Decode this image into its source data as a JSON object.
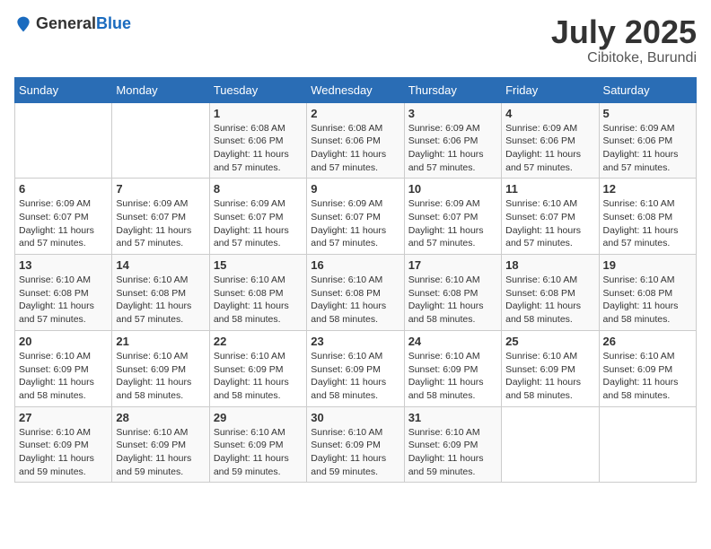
{
  "header": {
    "logo_general": "General",
    "logo_blue": "Blue",
    "month": "July 2025",
    "location": "Cibitoke, Burundi"
  },
  "days_of_week": [
    "Sunday",
    "Monday",
    "Tuesday",
    "Wednesday",
    "Thursday",
    "Friday",
    "Saturday"
  ],
  "weeks": [
    [
      {
        "day": "",
        "info": ""
      },
      {
        "day": "",
        "info": ""
      },
      {
        "day": "1",
        "info": "Sunrise: 6:08 AM\nSunset: 6:06 PM\nDaylight: 11 hours and 57 minutes."
      },
      {
        "day": "2",
        "info": "Sunrise: 6:08 AM\nSunset: 6:06 PM\nDaylight: 11 hours and 57 minutes."
      },
      {
        "day": "3",
        "info": "Sunrise: 6:09 AM\nSunset: 6:06 PM\nDaylight: 11 hours and 57 minutes."
      },
      {
        "day": "4",
        "info": "Sunrise: 6:09 AM\nSunset: 6:06 PM\nDaylight: 11 hours and 57 minutes."
      },
      {
        "day": "5",
        "info": "Sunrise: 6:09 AM\nSunset: 6:06 PM\nDaylight: 11 hours and 57 minutes."
      }
    ],
    [
      {
        "day": "6",
        "info": "Sunrise: 6:09 AM\nSunset: 6:07 PM\nDaylight: 11 hours and 57 minutes."
      },
      {
        "day": "7",
        "info": "Sunrise: 6:09 AM\nSunset: 6:07 PM\nDaylight: 11 hours and 57 minutes."
      },
      {
        "day": "8",
        "info": "Sunrise: 6:09 AM\nSunset: 6:07 PM\nDaylight: 11 hours and 57 minutes."
      },
      {
        "day": "9",
        "info": "Sunrise: 6:09 AM\nSunset: 6:07 PM\nDaylight: 11 hours and 57 minutes."
      },
      {
        "day": "10",
        "info": "Sunrise: 6:09 AM\nSunset: 6:07 PM\nDaylight: 11 hours and 57 minutes."
      },
      {
        "day": "11",
        "info": "Sunrise: 6:10 AM\nSunset: 6:07 PM\nDaylight: 11 hours and 57 minutes."
      },
      {
        "day": "12",
        "info": "Sunrise: 6:10 AM\nSunset: 6:08 PM\nDaylight: 11 hours and 57 minutes."
      }
    ],
    [
      {
        "day": "13",
        "info": "Sunrise: 6:10 AM\nSunset: 6:08 PM\nDaylight: 11 hours and 57 minutes."
      },
      {
        "day": "14",
        "info": "Sunrise: 6:10 AM\nSunset: 6:08 PM\nDaylight: 11 hours and 57 minutes."
      },
      {
        "day": "15",
        "info": "Sunrise: 6:10 AM\nSunset: 6:08 PM\nDaylight: 11 hours and 58 minutes."
      },
      {
        "day": "16",
        "info": "Sunrise: 6:10 AM\nSunset: 6:08 PM\nDaylight: 11 hours and 58 minutes."
      },
      {
        "day": "17",
        "info": "Sunrise: 6:10 AM\nSunset: 6:08 PM\nDaylight: 11 hours and 58 minutes."
      },
      {
        "day": "18",
        "info": "Sunrise: 6:10 AM\nSunset: 6:08 PM\nDaylight: 11 hours and 58 minutes."
      },
      {
        "day": "19",
        "info": "Sunrise: 6:10 AM\nSunset: 6:08 PM\nDaylight: 11 hours and 58 minutes."
      }
    ],
    [
      {
        "day": "20",
        "info": "Sunrise: 6:10 AM\nSunset: 6:09 PM\nDaylight: 11 hours and 58 minutes."
      },
      {
        "day": "21",
        "info": "Sunrise: 6:10 AM\nSunset: 6:09 PM\nDaylight: 11 hours and 58 minutes."
      },
      {
        "day": "22",
        "info": "Sunrise: 6:10 AM\nSunset: 6:09 PM\nDaylight: 11 hours and 58 minutes."
      },
      {
        "day": "23",
        "info": "Sunrise: 6:10 AM\nSunset: 6:09 PM\nDaylight: 11 hours and 58 minutes."
      },
      {
        "day": "24",
        "info": "Sunrise: 6:10 AM\nSunset: 6:09 PM\nDaylight: 11 hours and 58 minutes."
      },
      {
        "day": "25",
        "info": "Sunrise: 6:10 AM\nSunset: 6:09 PM\nDaylight: 11 hours and 58 minutes."
      },
      {
        "day": "26",
        "info": "Sunrise: 6:10 AM\nSunset: 6:09 PM\nDaylight: 11 hours and 58 minutes."
      }
    ],
    [
      {
        "day": "27",
        "info": "Sunrise: 6:10 AM\nSunset: 6:09 PM\nDaylight: 11 hours and 59 minutes."
      },
      {
        "day": "28",
        "info": "Sunrise: 6:10 AM\nSunset: 6:09 PM\nDaylight: 11 hours and 59 minutes."
      },
      {
        "day": "29",
        "info": "Sunrise: 6:10 AM\nSunset: 6:09 PM\nDaylight: 11 hours and 59 minutes."
      },
      {
        "day": "30",
        "info": "Sunrise: 6:10 AM\nSunset: 6:09 PM\nDaylight: 11 hours and 59 minutes."
      },
      {
        "day": "31",
        "info": "Sunrise: 6:10 AM\nSunset: 6:09 PM\nDaylight: 11 hours and 59 minutes."
      },
      {
        "day": "",
        "info": ""
      },
      {
        "day": "",
        "info": ""
      }
    ]
  ]
}
